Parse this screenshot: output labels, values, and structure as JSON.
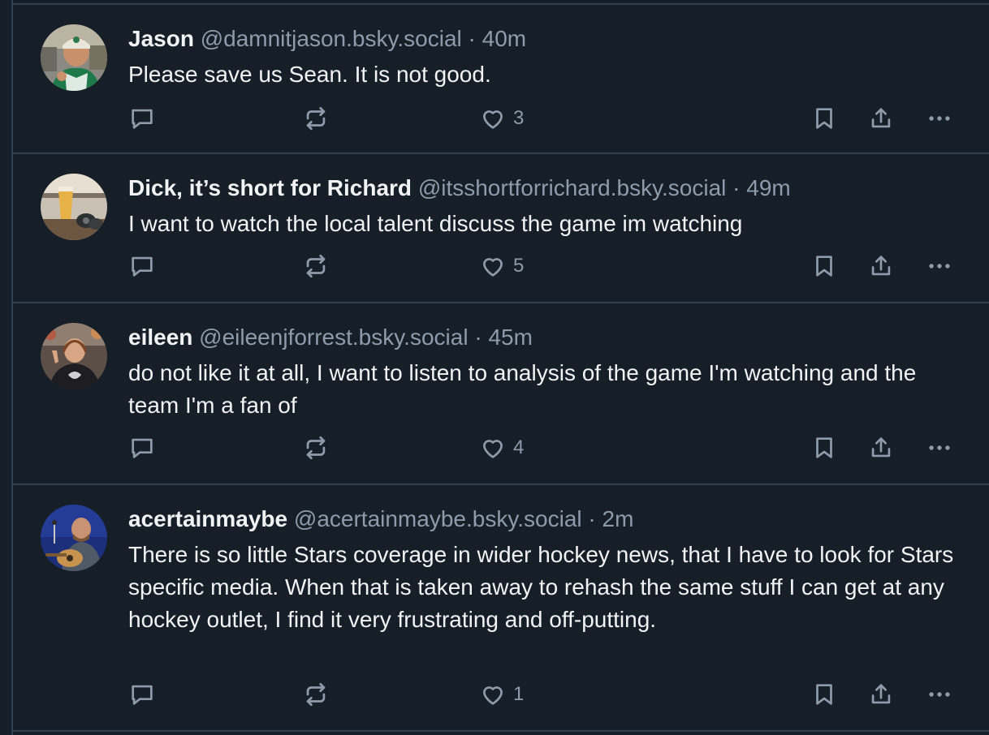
{
  "posts": [
    {
      "author": "Jason",
      "handle": "@damnitjason.bsky.social",
      "separator": "·",
      "time": "40m",
      "text": "Please save us Sean. It is not good.",
      "likes": "3",
      "icons": [
        "reply-icon",
        "repost-icon",
        "heart-icon",
        "bookmark-icon",
        "share-icon",
        "more-icon"
      ]
    },
    {
      "author": "Dick, it’s short for Richard",
      "handle": "@itsshortforrichard.bsky.social",
      "separator": "·",
      "time": "49m",
      "text": "I want to watch the local talent discuss the game im watching",
      "likes": "5",
      "icons": [
        "reply-icon",
        "repost-icon",
        "heart-icon",
        "bookmark-icon",
        "share-icon",
        "more-icon"
      ]
    },
    {
      "author": "eileen",
      "handle": "@eileenjforrest.bsky.social",
      "separator": "·",
      "time": "45m",
      "text": "do not like it at all, I want to listen to analysis of the game I'm watching and the team I'm a fan of",
      "likes": "4",
      "icons": [
        "reply-icon",
        "repost-icon",
        "heart-icon",
        "bookmark-icon",
        "share-icon",
        "more-icon"
      ]
    },
    {
      "author": "acertainmaybe",
      "handle": "@acertainmaybe.bsky.social",
      "separator": "·",
      "time": "2m",
      "text": "There is so little Stars coverage in wider hockey news, that I have to look for Stars specific media. When that is taken away to rehash the same stuff I can get at any hockey outlet, I find it very frustrating and off-putting.",
      "likes": "1",
      "icons": [
        "reply-icon",
        "repost-icon",
        "heart-icon",
        "bookmark-icon",
        "share-icon",
        "more-icon"
      ]
    }
  ],
  "colors": {
    "background": "#161e27",
    "divider": "#2e4052",
    "text": "#f1f3f5",
    "muted": "#8e9bab"
  }
}
